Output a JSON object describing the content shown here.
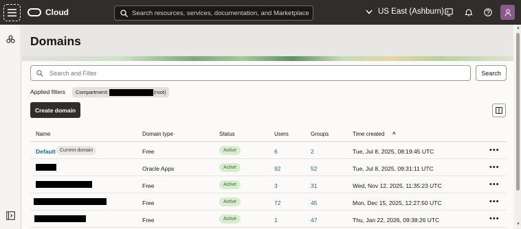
{
  "topbar": {
    "brand": "Cloud",
    "search_placeholder": "Search resources, services, documentation, and Marketplace",
    "region": "US East (Ashburn)",
    "icons": [
      "menu-icon",
      "oracle-logo",
      "search-icon",
      "chevron-down-icon",
      "cloud-shell-icon",
      "bell-icon",
      "help-icon",
      "user-icon"
    ]
  },
  "page": {
    "title": "Domains"
  },
  "filter": {
    "placeholder": "Search and Filter",
    "search_label": "Search",
    "applied_label": "Applied filters",
    "chip_prefix": "Compartment:",
    "chip_suffix": "(root)"
  },
  "actions": {
    "create_label": "Create domain"
  },
  "table": {
    "headers": {
      "name": "Name",
      "type": "Domain type",
      "status": "Status",
      "users": "Users",
      "groups": "Groups",
      "time": "Time created",
      "sort_indicator": "^"
    },
    "rows": [
      {
        "name": "Default",
        "current": "Current domain",
        "type": "Free",
        "status": "Active",
        "users": "6",
        "groups": "2",
        "time": "Tue, Jul 8, 2025, 08:19:45 UTC"
      },
      {
        "name": "",
        "type": "Oracle Apps",
        "status": "Active",
        "users": "92",
        "groups": "52",
        "time": "Tue, Jul 8, 2025, 09:31:11 UTC"
      },
      {
        "name": "",
        "type": "Free",
        "status": "Active",
        "users": "3",
        "groups": "31",
        "time": "Wed, Nov 12, 2025, 11:35:23 UTC"
      },
      {
        "name": "",
        "type": "Free",
        "status": "Active",
        "users": "72",
        "groups": "45",
        "time": "Mon, Dec 15, 2025, 12:27:50 UTC"
      },
      {
        "name": "",
        "type": "Free",
        "status": "Active",
        "users": "1",
        "groups": "47",
        "time": "Thu, Jan 22, 2026, 09:38:26 UTC"
      }
    ],
    "more_label": "•••"
  },
  "colors": {
    "topbar": "#312d2a",
    "link": "#1d6a8a",
    "active_badge_bg": "#d7ecd0",
    "active_badge_text": "#3f6b38",
    "avatar": "#8a5a8e"
  }
}
